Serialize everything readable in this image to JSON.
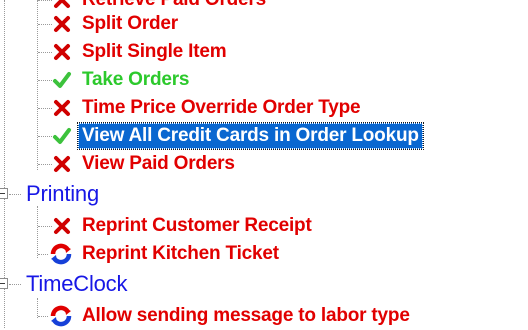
{
  "tree": {
    "items_top": [
      {
        "label": "Retrieve Paid Orders",
        "status": "denied",
        "color": "red"
      },
      {
        "label": "Split Order",
        "status": "denied",
        "color": "red"
      },
      {
        "label": "Split Single Item",
        "status": "denied",
        "color": "red"
      },
      {
        "label": "Take Orders",
        "status": "allowed",
        "color": "green"
      },
      {
        "label": "Time Price Override Order Type",
        "status": "denied",
        "color": "red"
      },
      {
        "label": "View All Credit Cards in Order Lookup",
        "status": "allowed",
        "color": "selected"
      },
      {
        "label": "View Paid Orders",
        "status": "denied",
        "color": "red"
      }
    ],
    "groups": [
      {
        "label": "Printing",
        "items": [
          {
            "label": "Reprint Customer Receipt",
            "status": "denied",
            "color": "red"
          },
          {
            "label": "Reprint Kitchen Ticket",
            "status": "inherited",
            "color": "red"
          }
        ]
      },
      {
        "label": "TimeClock",
        "items": [
          {
            "label": "Allow sending message to labor type",
            "status": "inherited",
            "color": "red"
          }
        ]
      }
    ]
  },
  "colors": {
    "denied": "#e10000",
    "allowed": "#2cc92c",
    "group": "#1717e6",
    "selection": "#0a67d0"
  },
  "icons": {
    "denied": "red-x-icon",
    "allowed": "green-check-icon",
    "inherited": "inherit-cycle-icon"
  }
}
